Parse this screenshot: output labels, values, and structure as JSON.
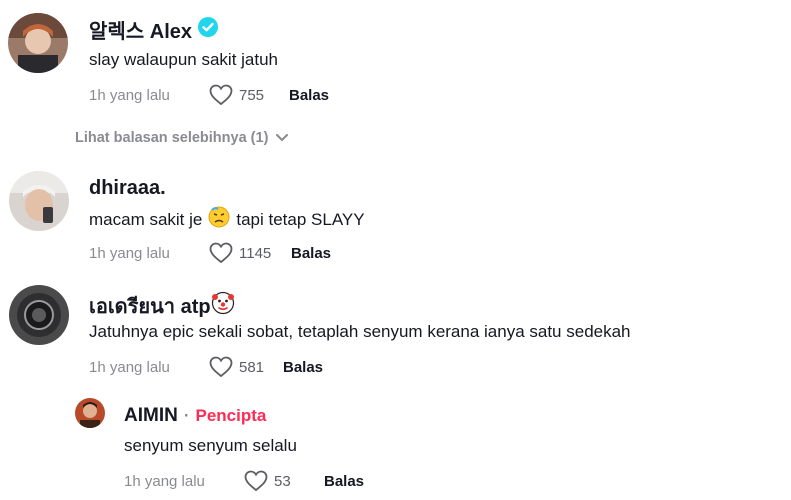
{
  "comments": [
    {
      "username": "알렉스 Alex",
      "text": "slay walaupun sakit jatuh",
      "time": "1h yang lalu",
      "likes": "755",
      "reply": "Balas",
      "verified": true
    },
    {
      "username": "dhiraaa.",
      "text_before": "macam sakit je",
      "text_after": "tapi tetap SLAYY",
      "time": "1h yang lalu",
      "likes": "1145",
      "reply": "Balas"
    },
    {
      "username": "เอเดรียนา atp",
      "text": "Jatuhnya epic sekali sobat, tetaplah senyum kerana ianya satu sedekah",
      "time": "1h yang lalu",
      "likes": "581",
      "reply": "Balas"
    },
    {
      "username": "AIMIN",
      "separator": "·",
      "badge": "Pencipta",
      "text": "senyum senyum selalu",
      "time": "1h yang lalu",
      "likes": "53",
      "reply": "Balas"
    }
  ],
  "view_more": {
    "label": "Lihat balasan selebihnya (1)"
  },
  "colors": {
    "creator": "#fe2c55",
    "verified": "#20d5ec",
    "muted": "#8a8b91",
    "text": "#161823"
  }
}
